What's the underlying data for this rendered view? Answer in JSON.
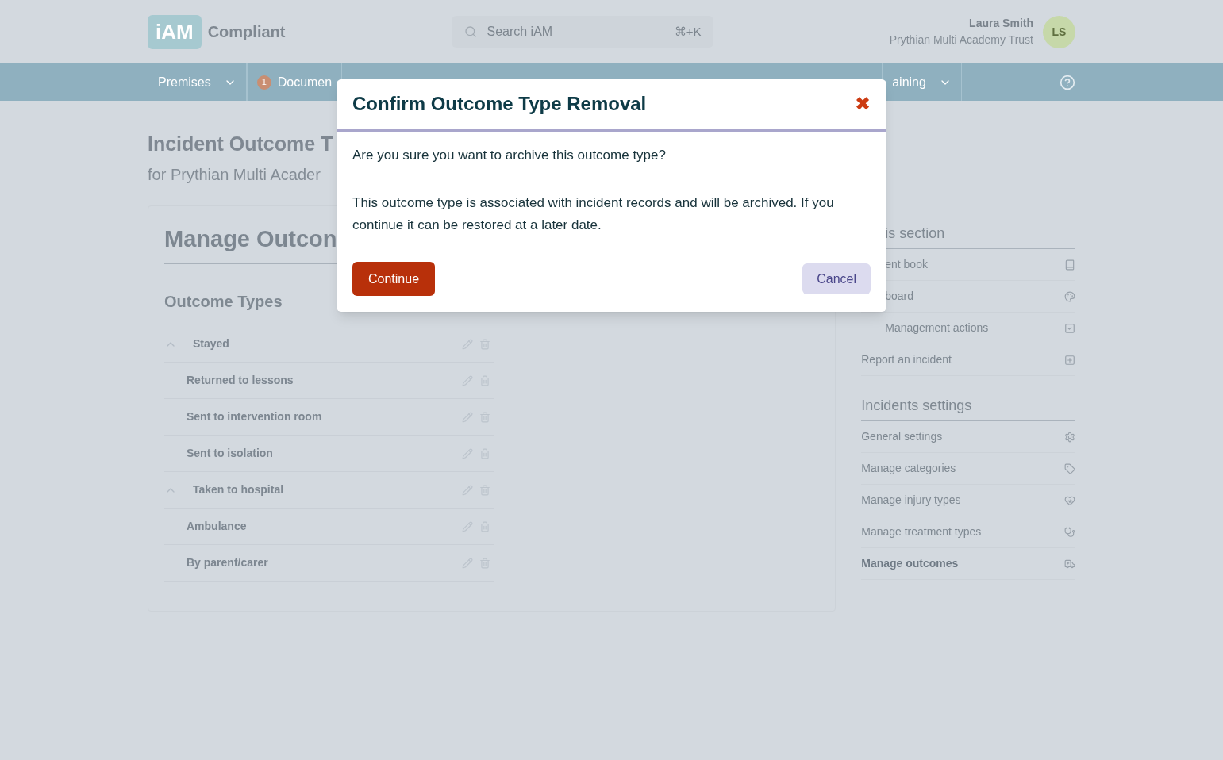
{
  "header": {
    "logo": "iAM",
    "app_name": "Compliant",
    "search": {
      "placeholder": "Search iAM",
      "shortcut": "⌘+K"
    },
    "user": {
      "name": "Laura Smith",
      "organisation": "Prythian Multi Academy Trust",
      "initials": "LS"
    }
  },
  "nav": [
    {
      "label": "Premises",
      "caret": true
    },
    {
      "label": "Documen",
      "badge": "1",
      "caret": false
    },
    {
      "label": "aining",
      "caret": true
    }
  ],
  "page": {
    "title": "Incident Outcome T",
    "subtitle": "for Prythian Multi Acader"
  },
  "card": {
    "title": "Manage Outcon",
    "section": "Outcome Types",
    "outcomes": [
      {
        "label": "Stayed",
        "expanded": true,
        "children": [
          {
            "label": "Returned to lessons"
          },
          {
            "label": "Sent to intervention room"
          },
          {
            "label": "Sent to isolation"
          }
        ]
      },
      {
        "label": "Taken to hospital",
        "expanded": true,
        "children": [
          {
            "label": "Ambulance"
          },
          {
            "label": "By parent/carer"
          }
        ]
      }
    ]
  },
  "sidebar": [
    {
      "heading": "is section",
      "items": [
        {
          "label": "ent book",
          "selected": false
        },
        {
          "label": "board",
          "selected": false
        },
        {
          "label": "Management actions",
          "selected": false
        },
        {
          "label": "Report an incident",
          "selected": false
        }
      ]
    },
    {
      "heading": "Incidents settings",
      "items": [
        {
          "label": "General settings",
          "selected": false
        },
        {
          "label": "Manage categories",
          "selected": false
        },
        {
          "label": "Manage injury types",
          "selected": false
        },
        {
          "label": "Manage treatment types",
          "selected": false
        },
        {
          "label": "Manage outcomes",
          "selected": true
        }
      ]
    }
  ],
  "modal": {
    "title": "Confirm Outcome Type Removal",
    "close": "✖",
    "paragraphs": [
      "Are you sure you want to archive this outcome type?",
      "This outcome type is associated with incident records and will be archived. If you continue it can be restored at a later date."
    ],
    "confirm": "Continue",
    "cancel": "Cancel"
  }
}
